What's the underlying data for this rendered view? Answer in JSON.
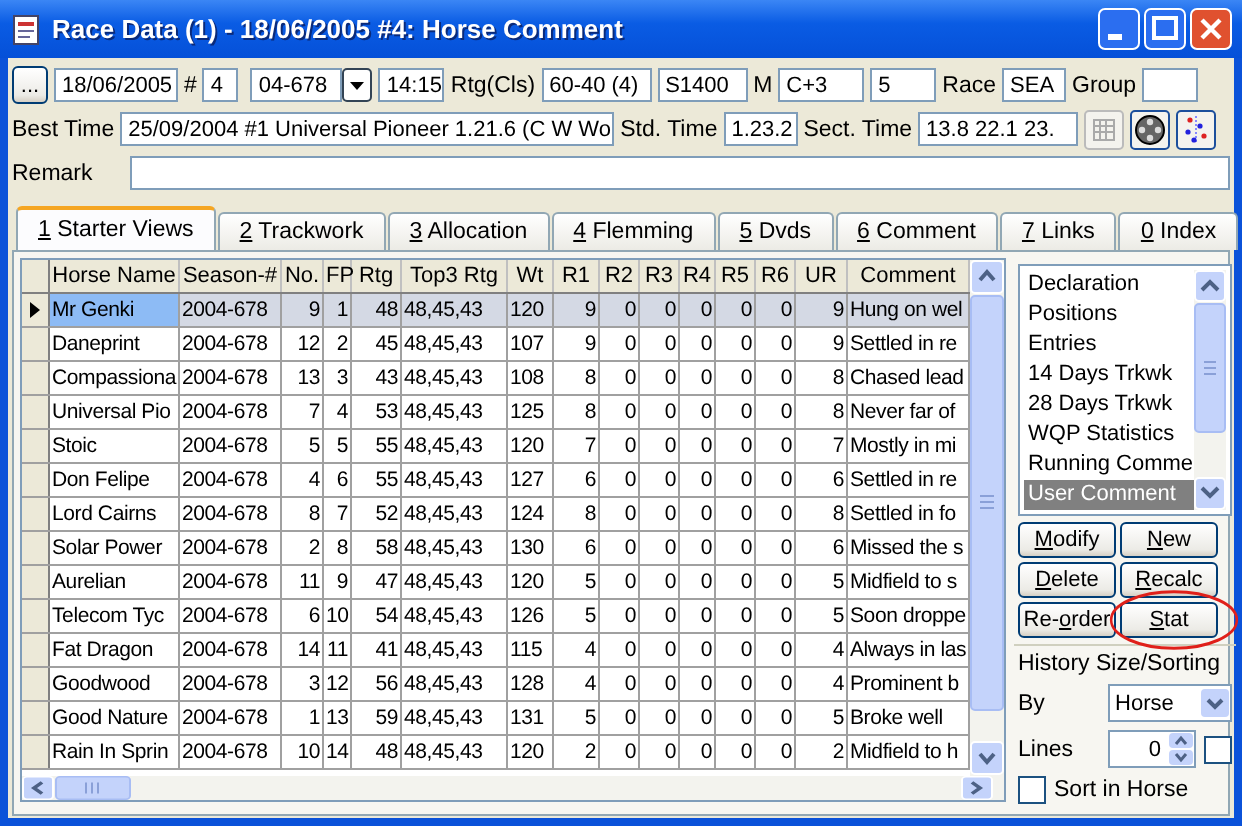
{
  "window": {
    "title": "Race Data (1) - 18/06/2005 #4: Horse Comment"
  },
  "header": {
    "browse_button": "...",
    "date": "18/06/2005",
    "number_label": "#",
    "number": "4",
    "season": "04-678",
    "time": "14:15",
    "rating_label": "Rtg(Cls)",
    "rating": "60-40 (4)",
    "distance": "S1400",
    "m_label": "M",
    "course": "C+3",
    "field_5": "5",
    "race_label": "Race",
    "race": "SEA",
    "group_label": "Group",
    "best_time_label": "Best Time",
    "best_time": "25/09/2004 #1 Universal Pioneer 1.21.6 (C W Wo",
    "std_time_label": "Std. Time",
    "std_time": "1.23.2",
    "sect_time_label": "Sect. Time",
    "sect_time": "13.8  22.1  23.",
    "remark_label": "Remark"
  },
  "tabs": [
    {
      "key": "1",
      "label": "Starter Views",
      "selected": true
    },
    {
      "key": "2",
      "label": "Trackwork",
      "selected": false
    },
    {
      "key": "3",
      "label": "Allocation",
      "selected": false
    },
    {
      "key": "4",
      "label": "Flemming",
      "selected": false
    },
    {
      "key": "5",
      "label": "Dvds",
      "selected": false
    },
    {
      "key": "6",
      "label": "Comment",
      "selected": false
    },
    {
      "key": "7",
      "label": "Links",
      "selected": false
    },
    {
      "key": "0",
      "label": "Index",
      "selected": false
    }
  ],
  "table": {
    "columns": [
      {
        "label": "Horse Name",
        "kind": "text"
      },
      {
        "label": "Season-#",
        "kind": "text"
      },
      {
        "label": "No.",
        "kind": "number"
      },
      {
        "label": "FP",
        "kind": "number"
      },
      {
        "label": "Rtg",
        "kind": "number"
      },
      {
        "label": "Top3 Rtg",
        "kind": "text"
      },
      {
        "label": "Wt",
        "kind": "text"
      },
      {
        "label": "R1",
        "kind": "number"
      },
      {
        "label": "R2",
        "kind": "number"
      },
      {
        "label": "R3",
        "kind": "number"
      },
      {
        "label": "R4",
        "kind": "number"
      },
      {
        "label": "R5",
        "kind": "number"
      },
      {
        "label": "R6",
        "kind": "number"
      },
      {
        "label": "UR",
        "kind": "number"
      },
      {
        "label": "Comment",
        "kind": "text"
      }
    ],
    "rows": [
      {
        "selected": true,
        "cells": [
          "Mr Genki",
          "2004-678",
          "9",
          "1",
          "48",
          "48,45,43",
          "120",
          "9",
          "0",
          "0",
          "0",
          "0",
          "0",
          "9",
          "Hung on wel"
        ]
      },
      {
        "selected": false,
        "cells": [
          "Daneprint",
          "2004-678",
          "12",
          "2",
          "45",
          "48,45,43",
          "107",
          "9",
          "0",
          "0",
          "0",
          "0",
          "0",
          "9",
          "Settled in re"
        ]
      },
      {
        "selected": false,
        "cells": [
          "Compassiona",
          "2004-678",
          "13",
          "3",
          "43",
          "48,45,43",
          "108",
          "8",
          "0",
          "0",
          "0",
          "0",
          "0",
          "8",
          "Chased lead"
        ]
      },
      {
        "selected": false,
        "cells": [
          "Universal Pio",
          "2004-678",
          "7",
          "4",
          "53",
          "48,45,43",
          "125",
          "8",
          "0",
          "0",
          "0",
          "0",
          "0",
          "8",
          "Never far of"
        ]
      },
      {
        "selected": false,
        "cells": [
          "Stoic",
          "2004-678",
          "5",
          "5",
          "55",
          "48,45,43",
          "120",
          "7",
          "0",
          "0",
          "0",
          "0",
          "0",
          "7",
          "Mostly in mi"
        ]
      },
      {
        "selected": false,
        "cells": [
          "Don Felipe",
          "2004-678",
          "4",
          "6",
          "55",
          "48,45,43",
          "127",
          "6",
          "0",
          "0",
          "0",
          "0",
          "0",
          "6",
          "Settled in re"
        ]
      },
      {
        "selected": false,
        "cells": [
          "Lord Cairns",
          "2004-678",
          "8",
          "7",
          "52",
          "48,45,43",
          "124",
          "8",
          "0",
          "0",
          "0",
          "0",
          "0",
          "8",
          "Settled in fo"
        ]
      },
      {
        "selected": false,
        "cells": [
          "Solar Power",
          "2004-678",
          "2",
          "8",
          "58",
          "48,45,43",
          "130",
          "6",
          "0",
          "0",
          "0",
          "0",
          "0",
          "6",
          "Missed the s"
        ]
      },
      {
        "selected": false,
        "cells": [
          "Aurelian",
          "2004-678",
          "11",
          "9",
          "47",
          "48,45,43",
          "120",
          "5",
          "0",
          "0",
          "0",
          "0",
          "0",
          "5",
          "Midfield to s"
        ]
      },
      {
        "selected": false,
        "cells": [
          "Telecom Tyc",
          "2004-678",
          "6",
          "10",
          "54",
          "48,45,43",
          "126",
          "5",
          "0",
          "0",
          "0",
          "0",
          "0",
          "5",
          "Soon droppe"
        ]
      },
      {
        "selected": false,
        "cells": [
          "Fat Dragon",
          "2004-678",
          "14",
          "11",
          "41",
          "48,45,43",
          "115",
          "4",
          "0",
          "0",
          "0",
          "0",
          "0",
          "4",
          "Always in las"
        ]
      },
      {
        "selected": false,
        "cells": [
          "Goodwood",
          "2004-678",
          "3",
          "12",
          "56",
          "48,45,43",
          "128",
          "4",
          "0",
          "0",
          "0",
          "0",
          "0",
          "4",
          "Prominent b"
        ]
      },
      {
        "selected": false,
        "cells": [
          "Good Nature",
          "2004-678",
          "1",
          "13",
          "59",
          "48,45,43",
          "131",
          "5",
          "0",
          "0",
          "0",
          "0",
          "0",
          "5",
          "Broke well"
        ]
      },
      {
        "selected": false,
        "cells": [
          "Rain In Sprin",
          "2004-678",
          "10",
          "14",
          "48",
          "48,45,43",
          "120",
          "2",
          "0",
          "0",
          "0",
          "0",
          "0",
          "2",
          "Midfield to h"
        ]
      }
    ]
  },
  "views": [
    {
      "label": "Declaration",
      "selected": false
    },
    {
      "label": "Positions",
      "selected": false
    },
    {
      "label": "Entries",
      "selected": false
    },
    {
      "label": "14 Days Trkwk",
      "selected": false
    },
    {
      "label": "28 Days Trkwk",
      "selected": false
    },
    {
      "label": "WQP Statistics",
      "selected": false
    },
    {
      "label": "Running Comme",
      "selected": false
    },
    {
      "label": "User Comment",
      "selected": true
    }
  ],
  "buttons": [
    {
      "key": "M",
      "post": "odify",
      "highlighted": false
    },
    {
      "key": "N",
      "post": "ew",
      "highlighted": false
    },
    {
      "key": "D",
      "post": "elete",
      "highlighted": false
    },
    {
      "key": "R",
      "post": "ecalc",
      "highlighted": false
    },
    {
      "pre": "Re-",
      "key": "o",
      "post": "rder",
      "highlighted": false
    },
    {
      "key": "S",
      "post": "tat",
      "highlighted": true
    }
  ],
  "history": {
    "title": "History Size/Sorting",
    "by_label": "By",
    "by_value": "Horse",
    "lines_label": "Lines",
    "lines_value": "0",
    "lines_checked": false,
    "sort_label": "Sort in Horse",
    "sort_checked": false
  }
}
